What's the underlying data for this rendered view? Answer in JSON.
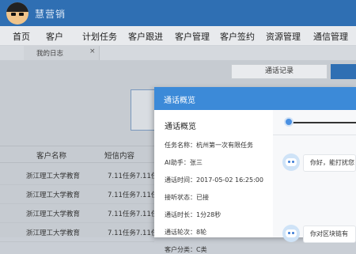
{
  "brand": {
    "name": "慧营销"
  },
  "nav": {
    "items": [
      "首页",
      "客户",
      "计划任务",
      "客户跟进",
      "客户管理",
      "客户签约",
      "资源管理",
      "通信管理"
    ]
  },
  "tabs": [
    {
      "label": "我的日志",
      "close": "×"
    }
  ],
  "toolbar": {
    "call_records": "通话记录"
  },
  "table": {
    "headers": [
      "客户名称",
      "短信内容"
    ],
    "rows": [
      [
        "浙江理工大学教育",
        "7.11任务7.11任"
      ],
      [
        "浙江理工大学教育",
        "7.11任务7.11任"
      ],
      [
        "浙江理工大学教育",
        "7.11任务7.11任"
      ],
      [
        "浙江理工大学教育",
        "7.11任务7.11任"
      ]
    ]
  },
  "modal": {
    "title": "通话概览",
    "section_title": "通话概览",
    "fields": [
      "任务名称：杭州第一次有限任务",
      "AI助手：张三",
      "通话时间：2017-05-02 16:25:00",
      "接听状态：已接",
      "通话时长：1分28秒",
      "通话轮次：8轮",
      "客户分类：C类"
    ],
    "messages": [
      "你好，能打扰您",
      "你对区块链有"
    ]
  }
}
